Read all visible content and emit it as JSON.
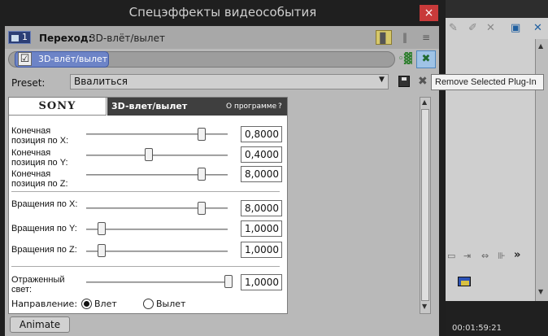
{
  "window": {
    "title": "Спецэффекты видеособытия",
    "close_glyph": "×"
  },
  "header": {
    "chain_number": "1",
    "label": "Переход:",
    "value": "3D-влёт/вылет",
    "view_icons": [
      "▊",
      "‖",
      "≡"
    ]
  },
  "chain": {
    "plugin_name": "3D-влёт/вылет",
    "check_glyph": "☑",
    "icon_bypass": "◦▓",
    "icon_remove": "✖"
  },
  "preset": {
    "label": "Preset:",
    "value": "Ввалиться",
    "arrow": "▼",
    "remove_glyph": "✖"
  },
  "tooltip": {
    "text": "Remove Selected Plug-In"
  },
  "plugin": {
    "brand": "SONY",
    "name": "3D-влет/вылет",
    "about": "О программе",
    "help": "?",
    "params": [
      {
        "label1": "Конечная",
        "label2": "позиция по X:",
        "value": "0,8000",
        "fraction": 0.8
      },
      {
        "label1": "Конечная",
        "label2": "позиция по Y:",
        "value": "0,4000",
        "fraction": 0.4
      },
      {
        "label1": "Конечная",
        "label2": "позиция по Z:",
        "value": "8,0000",
        "fraction": 0.8
      },
      {
        "label1": "Вращения по X:",
        "label2": "",
        "value": "8,0000",
        "fraction": 0.8
      },
      {
        "label1": "Вращения по Y:",
        "label2": "",
        "value": "1,0000",
        "fraction": 0.05
      },
      {
        "label1": "Вращения по Z:",
        "label2": "",
        "value": "1,0000",
        "fraction": 0.05
      },
      {
        "label1": "Отраженный",
        "label2": "свет:",
        "value": "1,0000",
        "fraction": 1.0
      }
    ],
    "direction_label": "Направление:",
    "direction_options": [
      "Влет",
      "Вылет"
    ],
    "direction_selected": "Влет"
  },
  "animate_button": "Animate",
  "background_app": {
    "timecode": "00:01:59:21",
    "more_glyph": "»"
  },
  "colors": {
    "accent": "#6d84c7",
    "title_bar": "#1f1f1f",
    "close": "#c83a3a"
  }
}
